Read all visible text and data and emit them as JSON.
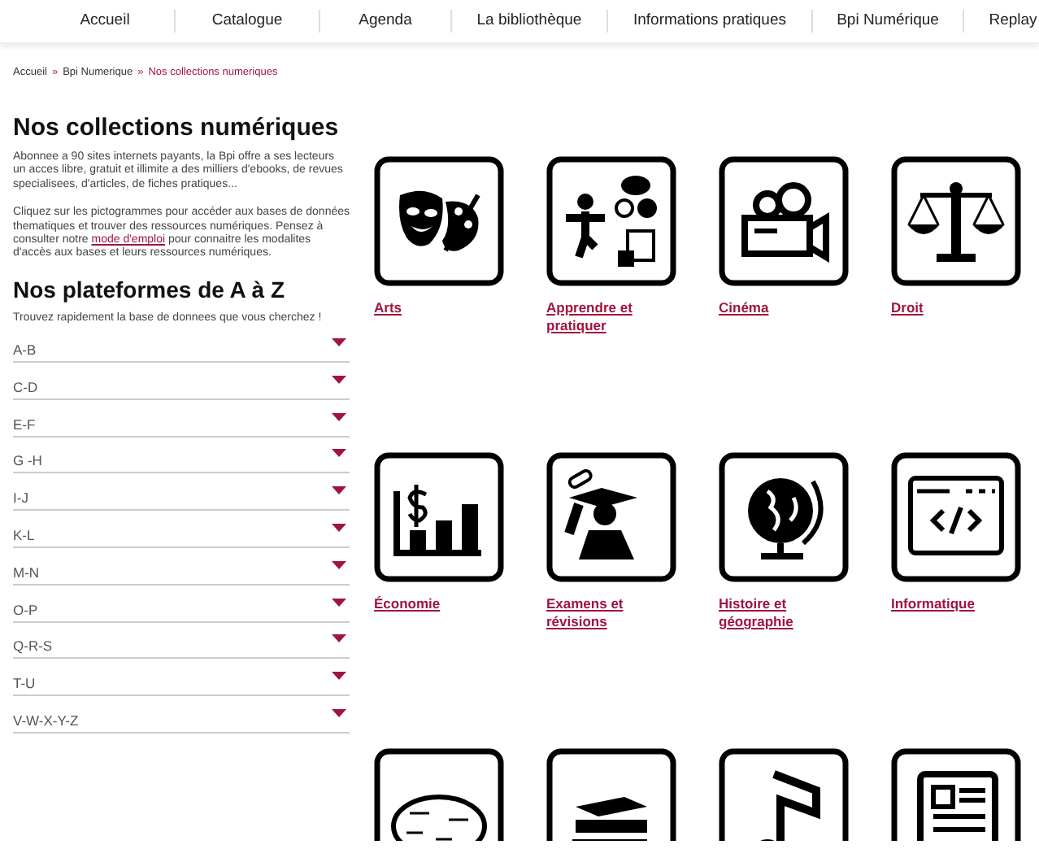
{
  "nav": [
    {
      "label": "Accueil"
    },
    {
      "label": "Catalogue"
    },
    {
      "label": "Agenda"
    },
    {
      "label": "La bibliothèque"
    },
    {
      "label": "Informations pratiques"
    },
    {
      "label": "Bpi Numérique"
    },
    {
      "label": "Replay"
    }
  ],
  "breadcrumb": {
    "items": [
      "Accueil",
      "Bpi Numerique"
    ],
    "separator": "»",
    "current": "Nos collections numeriques"
  },
  "title": "Nos collections numériques",
  "intro": "Abonnee a 90 sites internets payants, la Bpi offre a ses lecteurs un acces libre, gratuit et illimite a des milliers d'ebooks, de revues specialisees, d'articles, de fiches pratiques...",
  "help": {
    "before": "Cliquez sur les pictogrammes pour accéder aux bases de données thematiques et trouver des ressources numériques. Pensez à consulter notre",
    "link": "mode d'emploi",
    "after": "pour connaitre les modalites d'accès aux bases et leurs ressources numériques."
  },
  "az": {
    "title": "Nos plateformes de A à Z",
    "hint": "Trouvez rapidement la base de donnees que vous cherchez !",
    "items": [
      {
        "label": "A-B",
        "expanded": false
      },
      {
        "label": "C-D",
        "expanded": false
      },
      {
        "label": "E-F",
        "expanded": false
      },
      {
        "label": "G -H",
        "expanded": false
      },
      {
        "label": "I-J",
        "expanded": false
      },
      {
        "label": "K-L",
        "expanded": false
      },
      {
        "label": "M-N",
        "expanded": false
      },
      {
        "label": "O-P",
        "expanded": false
      },
      {
        "label": "Q-R-S",
        "expanded": false
      },
      {
        "label": "T-U",
        "expanded": false
      },
      {
        "label": "V-W-X-Y-Z",
        "expanded": false
      }
    ]
  },
  "tiles": [
    {
      "kind": "linked",
      "label": "Arts"
    },
    {
      "kind": "linked",
      "label": "Apprendre et pratiquer"
    },
    {
      "kind": "linked",
      "label": "Cinéma"
    },
    {
      "kind": "linked",
      "label": "Droit"
    },
    {
      "kind": "linked",
      "label": "Économie"
    },
    {
      "kind": "linked",
      "label": "Examens et révisions"
    },
    {
      "kind": "linked",
      "label": "Histoire et géographie"
    },
    {
      "kind": "linked",
      "label": "Informatique"
    },
    {
      "kind": "icon"
    },
    {
      "kind": "icon"
    },
    {
      "kind": "icon"
    },
    {
      "kind": "icon"
    }
  ]
}
